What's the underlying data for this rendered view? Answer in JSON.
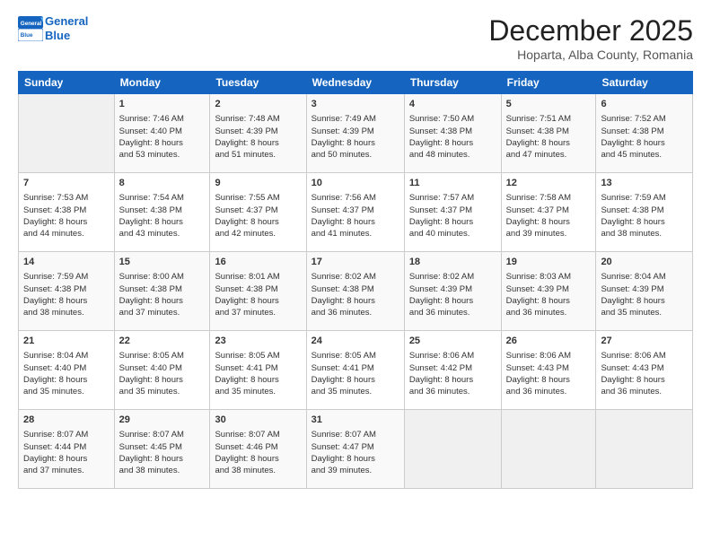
{
  "logo": {
    "line1": "General",
    "line2": "Blue"
  },
  "title": "December 2025",
  "subtitle": "Hoparta, Alba County, Romania",
  "days_header": [
    "Sunday",
    "Monday",
    "Tuesday",
    "Wednesday",
    "Thursday",
    "Friday",
    "Saturday"
  ],
  "weeks": [
    [
      {
        "num": "",
        "text": ""
      },
      {
        "num": "1",
        "text": "Sunrise: 7:46 AM\nSunset: 4:40 PM\nDaylight: 8 hours\nand 53 minutes."
      },
      {
        "num": "2",
        "text": "Sunrise: 7:48 AM\nSunset: 4:39 PM\nDaylight: 8 hours\nand 51 minutes."
      },
      {
        "num": "3",
        "text": "Sunrise: 7:49 AM\nSunset: 4:39 PM\nDaylight: 8 hours\nand 50 minutes."
      },
      {
        "num": "4",
        "text": "Sunrise: 7:50 AM\nSunset: 4:38 PM\nDaylight: 8 hours\nand 48 minutes."
      },
      {
        "num": "5",
        "text": "Sunrise: 7:51 AM\nSunset: 4:38 PM\nDaylight: 8 hours\nand 47 minutes."
      },
      {
        "num": "6",
        "text": "Sunrise: 7:52 AM\nSunset: 4:38 PM\nDaylight: 8 hours\nand 45 minutes."
      }
    ],
    [
      {
        "num": "7",
        "text": "Sunrise: 7:53 AM\nSunset: 4:38 PM\nDaylight: 8 hours\nand 44 minutes."
      },
      {
        "num": "8",
        "text": "Sunrise: 7:54 AM\nSunset: 4:38 PM\nDaylight: 8 hours\nand 43 minutes."
      },
      {
        "num": "9",
        "text": "Sunrise: 7:55 AM\nSunset: 4:37 PM\nDaylight: 8 hours\nand 42 minutes."
      },
      {
        "num": "10",
        "text": "Sunrise: 7:56 AM\nSunset: 4:37 PM\nDaylight: 8 hours\nand 41 minutes."
      },
      {
        "num": "11",
        "text": "Sunrise: 7:57 AM\nSunset: 4:37 PM\nDaylight: 8 hours\nand 40 minutes."
      },
      {
        "num": "12",
        "text": "Sunrise: 7:58 AM\nSunset: 4:37 PM\nDaylight: 8 hours\nand 39 minutes."
      },
      {
        "num": "13",
        "text": "Sunrise: 7:59 AM\nSunset: 4:38 PM\nDaylight: 8 hours\nand 38 minutes."
      }
    ],
    [
      {
        "num": "14",
        "text": "Sunrise: 7:59 AM\nSunset: 4:38 PM\nDaylight: 8 hours\nand 38 minutes."
      },
      {
        "num": "15",
        "text": "Sunrise: 8:00 AM\nSunset: 4:38 PM\nDaylight: 8 hours\nand 37 minutes."
      },
      {
        "num": "16",
        "text": "Sunrise: 8:01 AM\nSunset: 4:38 PM\nDaylight: 8 hours\nand 37 minutes."
      },
      {
        "num": "17",
        "text": "Sunrise: 8:02 AM\nSunset: 4:38 PM\nDaylight: 8 hours\nand 36 minutes."
      },
      {
        "num": "18",
        "text": "Sunrise: 8:02 AM\nSunset: 4:39 PM\nDaylight: 8 hours\nand 36 minutes."
      },
      {
        "num": "19",
        "text": "Sunrise: 8:03 AM\nSunset: 4:39 PM\nDaylight: 8 hours\nand 36 minutes."
      },
      {
        "num": "20",
        "text": "Sunrise: 8:04 AM\nSunset: 4:39 PM\nDaylight: 8 hours\nand 35 minutes."
      }
    ],
    [
      {
        "num": "21",
        "text": "Sunrise: 8:04 AM\nSunset: 4:40 PM\nDaylight: 8 hours\nand 35 minutes."
      },
      {
        "num": "22",
        "text": "Sunrise: 8:05 AM\nSunset: 4:40 PM\nDaylight: 8 hours\nand 35 minutes."
      },
      {
        "num": "23",
        "text": "Sunrise: 8:05 AM\nSunset: 4:41 PM\nDaylight: 8 hours\nand 35 minutes."
      },
      {
        "num": "24",
        "text": "Sunrise: 8:05 AM\nSunset: 4:41 PM\nDaylight: 8 hours\nand 35 minutes."
      },
      {
        "num": "25",
        "text": "Sunrise: 8:06 AM\nSunset: 4:42 PM\nDaylight: 8 hours\nand 36 minutes."
      },
      {
        "num": "26",
        "text": "Sunrise: 8:06 AM\nSunset: 4:43 PM\nDaylight: 8 hours\nand 36 minutes."
      },
      {
        "num": "27",
        "text": "Sunrise: 8:06 AM\nSunset: 4:43 PM\nDaylight: 8 hours\nand 36 minutes."
      }
    ],
    [
      {
        "num": "28",
        "text": "Sunrise: 8:07 AM\nSunset: 4:44 PM\nDaylight: 8 hours\nand 37 minutes."
      },
      {
        "num": "29",
        "text": "Sunrise: 8:07 AM\nSunset: 4:45 PM\nDaylight: 8 hours\nand 38 minutes."
      },
      {
        "num": "30",
        "text": "Sunrise: 8:07 AM\nSunset: 4:46 PM\nDaylight: 8 hours\nand 38 minutes."
      },
      {
        "num": "31",
        "text": "Sunrise: 8:07 AM\nSunset: 4:47 PM\nDaylight: 8 hours\nand 39 minutes."
      },
      {
        "num": "",
        "text": ""
      },
      {
        "num": "",
        "text": ""
      },
      {
        "num": "",
        "text": ""
      }
    ]
  ]
}
